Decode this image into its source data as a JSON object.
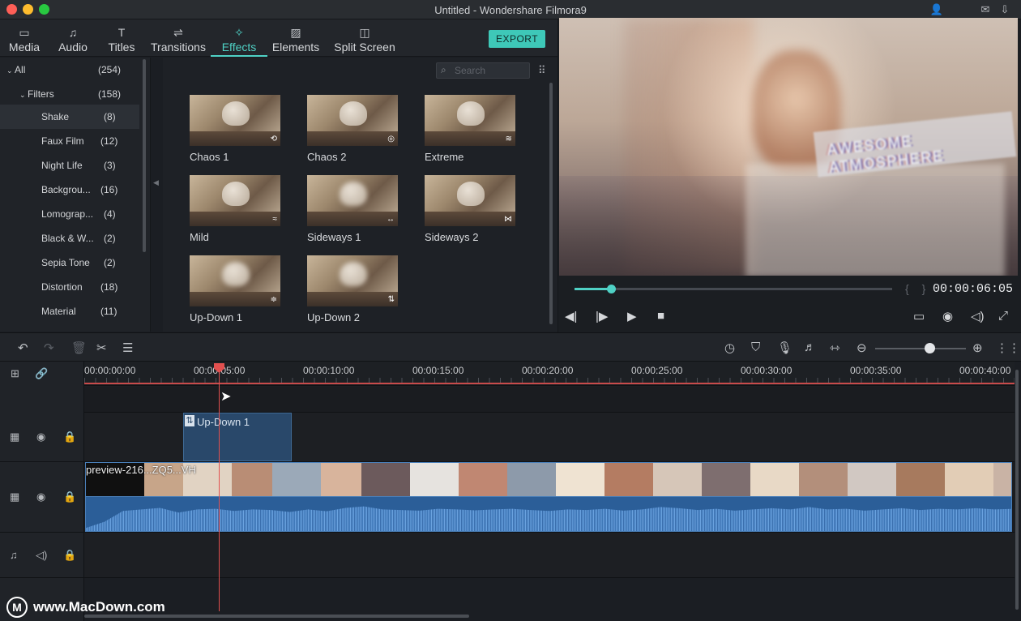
{
  "window": {
    "title": "Untitled - Wondershare Filmora9",
    "colors": {
      "close": "#fe5f57",
      "minimize": "#febc2e",
      "maximize": "#28c840",
      "accent": "#4fd1c5"
    }
  },
  "tabs": [
    {
      "label": "Media",
      "icon": "folder-icon"
    },
    {
      "label": "Audio",
      "icon": "music-note-icon"
    },
    {
      "label": "Titles",
      "icon": "text-icon"
    },
    {
      "label": "Transitions",
      "icon": "transition-icon"
    },
    {
      "label": "Effects",
      "icon": "effects-icon"
    },
    {
      "label": "Elements",
      "icon": "image-icon"
    },
    {
      "label": "Split Screen",
      "icon": "split-screen-icon"
    }
  ],
  "export_label": "EXPORT",
  "categories": [
    {
      "name": "All",
      "count": "(254)"
    },
    {
      "name": "Filters",
      "count": "(158)"
    },
    {
      "name": "Shake",
      "count": "(8)"
    },
    {
      "name": "Faux Film",
      "count": "(12)"
    },
    {
      "name": "Night Life",
      "count": "(3)"
    },
    {
      "name": "Backgrou...",
      "count": "(16)"
    },
    {
      "name": "Lomograp...",
      "count": "(4)"
    },
    {
      "name": "Black & W...",
      "count": "(2)"
    },
    {
      "name": "Sepia Tone",
      "count": "(2)"
    },
    {
      "name": "Distortion",
      "count": "(18)"
    },
    {
      "name": "Material",
      "count": "(11)"
    }
  ],
  "search": {
    "placeholder": "Search"
  },
  "effects": [
    {
      "name": "Chaos 1",
      "badge": "⟲"
    },
    {
      "name": "Chaos 2",
      "badge": "◎"
    },
    {
      "name": "Extreme",
      "badge": "≋"
    },
    {
      "name": "Mild",
      "badge": "≈"
    },
    {
      "name": "Sideways 1",
      "badge": "↔"
    },
    {
      "name": "Sideways 2",
      "badge": "⋈"
    },
    {
      "name": "Up-Down 1",
      "badge": "≑"
    },
    {
      "name": "Up-Down 2",
      "badge": "⇅"
    }
  ],
  "preview": {
    "overlay_text": "AWESOME ATMOSPHERE",
    "timecode": "00:00:06:05",
    "progress": 0.115
  },
  "timeline": {
    "ruler": [
      "00:00:00:00",
      "00:00:05:00",
      "00:00:10:00",
      "00:00:15:00",
      "00:00:20:00",
      "00:00:25:00",
      "00:00:30:00",
      "00:00:35:00",
      "00:00:40:00"
    ],
    "fx_clip_label": "Up-Down 1",
    "video_clip_label": "preview-216...ZQ5...VH",
    "zoom_level": 0.6
  },
  "watermark": "www.MacDown.com"
}
